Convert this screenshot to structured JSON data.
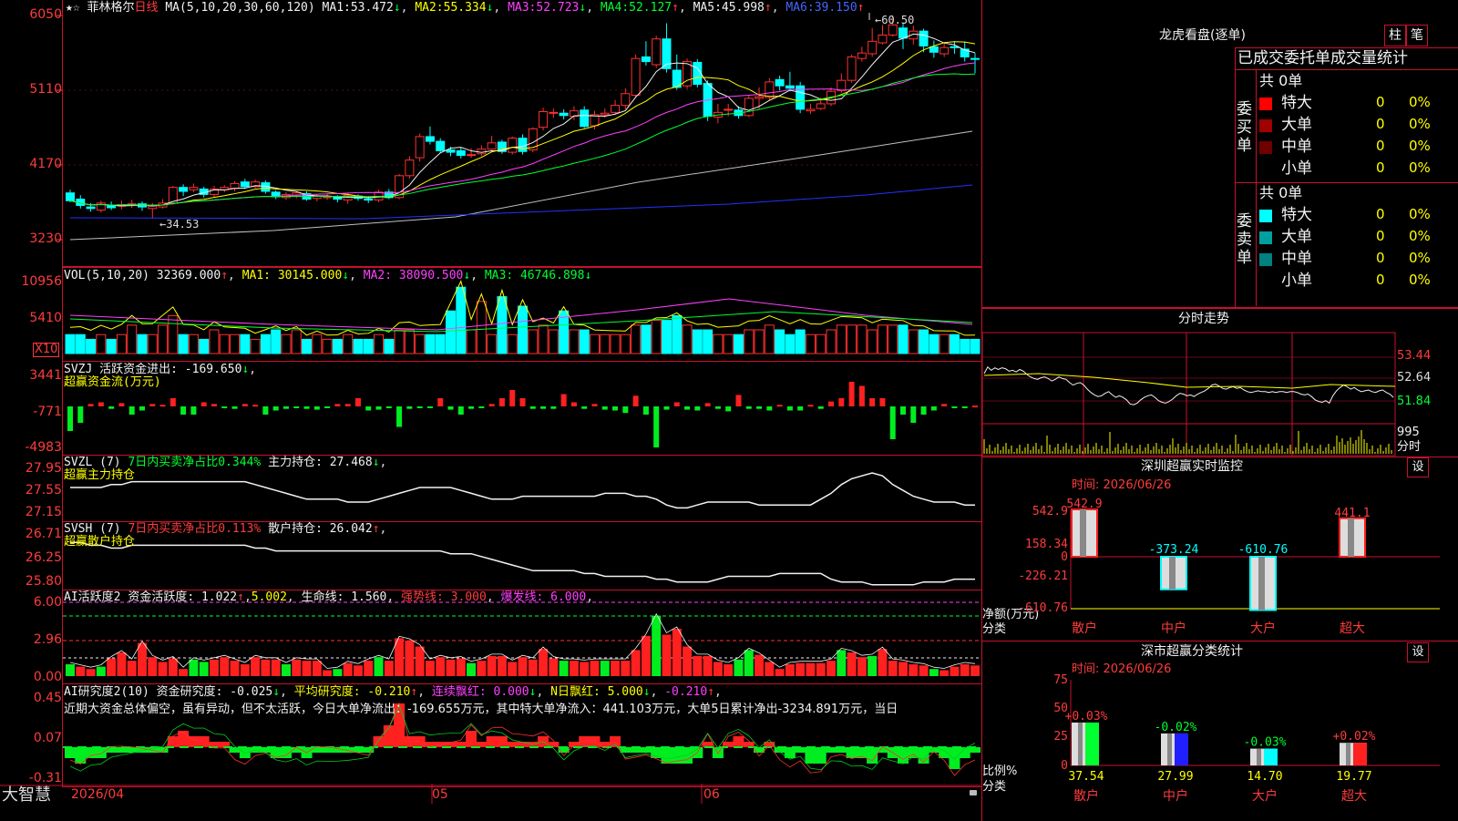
{
  "stock": {
    "name": "菲林格尔",
    "period": "日线"
  },
  "k": {
    "ma_label": "MA(5,10,20,30,60,120)",
    "ma": [
      {
        "k": "MA1:",
        "v": "53.472",
        "a": "↓",
        "c": "wht"
      },
      {
        "k": "MA2:",
        "v": "55.334",
        "a": "↓",
        "c": "yel"
      },
      {
        "k": "MA3:",
        "v": "52.723",
        "a": "↓",
        "c": "mag"
      },
      {
        "k": "MA4:",
        "v": "52.127",
        "a": "↑",
        "c": "grn"
      },
      {
        "k": "MA5:",
        "v": "45.998",
        "a": "↑",
        "c": "wht"
      },
      {
        "k": "MA6:",
        "v": "39.150",
        "a": "↑",
        "c": "blu"
      }
    ],
    "axis": [
      "6050",
      "5110",
      "4170",
      "3230"
    ],
    "high_mark": "60.50",
    "low_mark": "34.53"
  },
  "vol": {
    "label": "VOL(5,10,20)",
    "val": "32369.000",
    "a": "↑",
    "ma": [
      {
        "k": "MA1:",
        "v": "30145.000",
        "a": "↓",
        "c": "yel"
      },
      {
        "k": "MA2:",
        "v": "38090.500",
        "a": "↓",
        "c": "mag"
      },
      {
        "k": "MA3:",
        "v": "46746.898",
        "a": "↓",
        "c": "grn"
      }
    ],
    "axis": [
      "10956",
      "5410"
    ],
    "unit": "X10"
  },
  "svzj": {
    "label": "SVZJ",
    "title": "活跃资金进出:",
    "val": "-169.650",
    "a": "↓",
    "sub": "超赢资金流(万元)",
    "axis": [
      "3441",
      "-771",
      "-4983"
    ]
  },
  "svzl": {
    "label": "SVZL (7)",
    "t1": "7日内买卖净占比0.344%",
    "t2": "主力持仓:",
    "v2": "27.468",
    "a": "↓",
    "sub": "超赢主力持仓",
    "axis": [
      "27.95",
      "27.55",
      "27.15"
    ]
  },
  "svsh": {
    "label": "SVSH (7)",
    "t1": "7日内买卖净占比0.113%",
    "t2": "散户持仓:",
    "v2": "26.042",
    "a": "↑",
    "sub": "超赢散户持仓",
    "axis": [
      "26.71",
      "26.25",
      "25.80"
    ]
  },
  "ai1": {
    "label": "AI活跃度2",
    "t1": "资金活跃度:",
    "v1": "1.022",
    "a1": "↑",
    "v2": "5.002",
    "t3": "生命线:",
    "v3": "1.560",
    "t4": "强势线:",
    "v4": "3.000",
    "t5": "爆发线:",
    "v5": "6.000",
    "axis": [
      "6.00",
      "2.96",
      "0.00"
    ]
  },
  "ai2": {
    "label": "AI研究度2(10)",
    "t1": "资金研究度:",
    "v1": "-0.025",
    "a1": "↓",
    "t2": "平均研究度:",
    "v2": "-0.210",
    "a2": "↑",
    "t3": "连续飘红:",
    "v3": "0.000",
    "a3": "↓",
    "t4": "N日飘红:",
    "v4": "5.000",
    "a4": "↓",
    "v5": "-0.210",
    "a5": "↑",
    "comment": "近期大资金总体偏空，虽有异动，但不太活跃，今日大单净流出：-169.655万元，其中特大单净流入：441.103万元，大单5日累计净出-3234.891万元，当日",
    "axis": [
      "0.45",
      "0.07",
      "-0.31"
    ]
  },
  "bottom": {
    "brand": "大智慧",
    "date": "2026/04",
    "m5": "05",
    "m6": "06"
  },
  "longhu": {
    "title": "龙虎看盘(逐单)",
    "btn1": "柱",
    "btn2": "笔",
    "tabs": "已成交委托单成交量统计",
    "buy": {
      "side": "委买单",
      "total": "共 0单",
      "rows": [
        {
          "n": "特大",
          "v": "0",
          "p": "0%",
          "c": "#ff0000"
        },
        {
          "n": "大单",
          "v": "0",
          "p": "0%",
          "c": "#a00000"
        },
        {
          "n": "中单",
          "v": "0",
          "p": "0%",
          "c": "#700000"
        },
        {
          "n": "小单",
          "v": "0",
          "p": "0%",
          "c": "#000"
        }
      ]
    },
    "sell": {
      "side": "委卖单",
      "total": "共 0单",
      "rows": [
        {
          "n": "特大",
          "v": "0",
          "p": "0%",
          "c": "#00ffff"
        },
        {
          "n": "大单",
          "v": "0",
          "p": "0%",
          "c": "#00a0a0"
        },
        {
          "n": "中单",
          "v": "0",
          "p": "0%",
          "c": "#008080"
        },
        {
          "n": "小单",
          "v": "0",
          "p": "0%",
          "c": "#000"
        }
      ]
    }
  },
  "fenshi": {
    "title": "分时走势",
    "axis": [
      "53.44",
      "52.64",
      "51.84"
    ],
    "vol": "995",
    "unit": "分时"
  },
  "monitor": {
    "title": "深圳超赢实时监控",
    "btn": "设",
    "time": "时间: 2026/06/26",
    "axis": [
      "542.9",
      "158.34",
      "0",
      "-226.21",
      "-610.76"
    ],
    "ylabel": "净额(万元)",
    "xlabel": "分类",
    "bars": [
      {
        "n": "散户",
        "v": "542.9"
      },
      {
        "n": "中户",
        "v": "-373.24"
      },
      {
        "n": "大户",
        "v": "-610.76"
      },
      {
        "n": "超大",
        "v": "441.1"
      }
    ]
  },
  "classify": {
    "title": "深市超赢分类统计",
    "btn": "设",
    "time": "时间: 2026/06/26",
    "axis": [
      "75",
      "50",
      "25",
      "0"
    ],
    "ylabel": "比例%",
    "xlabel": "分类",
    "bars": [
      {
        "n": "散户",
        "v": "37.54",
        "d": "+0.03%"
      },
      {
        "n": "中户",
        "v": "27.99",
        "d": "-0.02%"
      },
      {
        "n": "大户",
        "v": "14.70",
        "d": "-0.03%"
      },
      {
        "n": "超大",
        "v": "19.77",
        "d": "+0.02%"
      }
    ]
  },
  "chart_data": {
    "type": "bar",
    "title": "深圳超赢实时监控",
    "categories": [
      "散户",
      "中户",
      "大户",
      "超大"
    ],
    "values": [
      542.9,
      -373.24,
      -610.76,
      441.1
    ],
    "ylabel": "净额(万元)",
    "xlabel": "分类"
  }
}
